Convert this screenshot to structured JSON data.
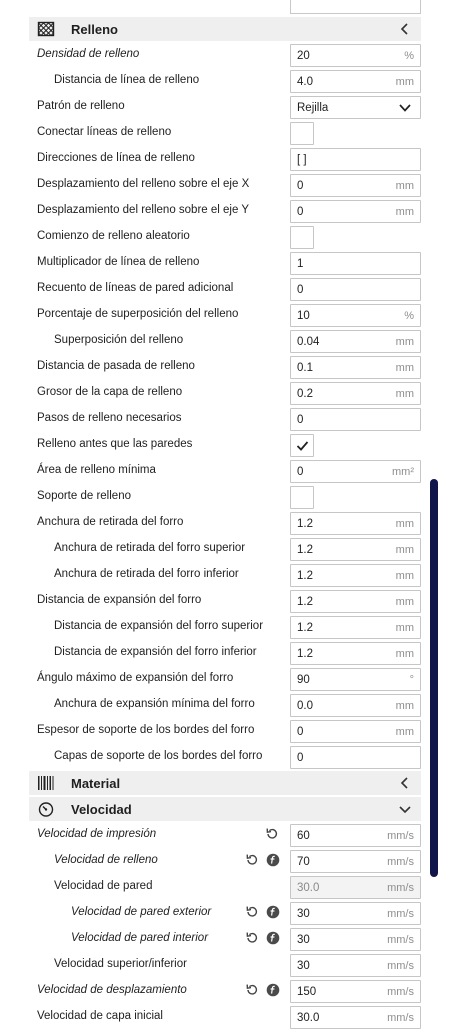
{
  "sections": {
    "infill": {
      "title": "Relleno"
    },
    "material": {
      "title": "Material"
    },
    "speed": {
      "title": "Velocidad"
    }
  },
  "infill_settings": [
    {
      "label": "Densidad de relleno",
      "value": "20",
      "unit": "%",
      "type": "text",
      "indent": 0,
      "italic": true
    },
    {
      "label": "Distancia de línea de relleno",
      "value": "4.0",
      "unit": "mm",
      "type": "text",
      "indent": 1
    },
    {
      "label": "Patrón de relleno",
      "value": "Rejilla",
      "type": "combo",
      "indent": 0
    },
    {
      "label": "Conectar líneas de relleno",
      "type": "check",
      "checked": false,
      "indent": 0
    },
    {
      "label": "Direcciones de línea de relleno",
      "value": "[ ]",
      "unit": "",
      "type": "text",
      "indent": 0
    },
    {
      "label": "Desplazamiento del relleno sobre el eje X",
      "value": "0",
      "unit": "mm",
      "type": "text",
      "indent": 0
    },
    {
      "label": "Desplazamiento del relleno sobre el eje Y",
      "value": "0",
      "unit": "mm",
      "type": "text",
      "indent": 0
    },
    {
      "label": "Comienzo de relleno aleatorio",
      "type": "check",
      "checked": false,
      "indent": 0
    },
    {
      "label": "Multiplicador de línea de relleno",
      "value": "1",
      "unit": "",
      "type": "text",
      "indent": 0
    },
    {
      "label": "Recuento de líneas de pared adicional",
      "value": "0",
      "unit": "",
      "type": "text",
      "indent": 0
    },
    {
      "label": "Porcentaje de superposición del relleno",
      "value": "10",
      "unit": "%",
      "type": "text",
      "indent": 0
    },
    {
      "label": "Superposición del relleno",
      "value": "0.04",
      "unit": "mm",
      "type": "text",
      "indent": 1
    },
    {
      "label": "Distancia de pasada de relleno",
      "value": "0.1",
      "unit": "mm",
      "type": "text",
      "indent": 0
    },
    {
      "label": "Grosor de la capa de relleno",
      "value": "0.2",
      "unit": "mm",
      "type": "text",
      "indent": 0
    },
    {
      "label": "Pasos de relleno necesarios",
      "value": "0",
      "unit": "",
      "type": "text",
      "indent": 0
    },
    {
      "label": "Relleno antes que las paredes",
      "type": "check",
      "checked": true,
      "indent": 0
    },
    {
      "label": "Área de relleno mínima",
      "value": "0",
      "unit": "mm²",
      "type": "text",
      "indent": 0
    },
    {
      "label": "Soporte de relleno",
      "type": "check",
      "checked": false,
      "indent": 0
    },
    {
      "label": "Anchura de retirada del forro",
      "value": "1.2",
      "unit": "mm",
      "type": "text",
      "indent": 0
    },
    {
      "label": "Anchura de retirada del forro superior",
      "value": "1.2",
      "unit": "mm",
      "type": "text",
      "indent": 1
    },
    {
      "label": "Anchura de retirada del forro inferior",
      "value": "1.2",
      "unit": "mm",
      "type": "text",
      "indent": 1
    },
    {
      "label": "Distancia de expansión del forro",
      "value": "1.2",
      "unit": "mm",
      "type": "text",
      "indent": 0
    },
    {
      "label": "Distancia de expansión del forro superior",
      "value": "1.2",
      "unit": "mm",
      "type": "text",
      "indent": 1
    },
    {
      "label": "Distancia de expansión del forro inferior",
      "value": "1.2",
      "unit": "mm",
      "type": "text",
      "indent": 1
    },
    {
      "label": "Ángulo máximo de expansión del forro",
      "value": "90",
      "unit": "°",
      "type": "text",
      "indent": 0
    },
    {
      "label": "Anchura de expansión mínima del forro",
      "value": "0.0",
      "unit": "mm",
      "type": "text",
      "indent": 1
    },
    {
      "label": "Espesor de soporte de los bordes del forro",
      "value": "0",
      "unit": "mm",
      "type": "text",
      "indent": 0
    },
    {
      "label": "Capas de soporte de los bordes del forro",
      "value": "0",
      "unit": "",
      "type": "text",
      "indent": 1
    }
  ],
  "speed_settings": [
    {
      "label": "Velocidad de impresión",
      "value": "60",
      "unit": "mm/s",
      "type": "text",
      "indent": 0,
      "italic": true,
      "reset": true
    },
    {
      "label": "Velocidad de relleno",
      "value": "70",
      "unit": "mm/s",
      "type": "text",
      "indent": 1,
      "italic": true,
      "reset": true,
      "fx": true
    },
    {
      "label": "Velocidad de pared",
      "value": "30.0",
      "unit": "mm/s",
      "type": "text",
      "indent": 1,
      "disabled": true
    },
    {
      "label": "Velocidad de pared exterior",
      "value": "30",
      "unit": "mm/s",
      "type": "text",
      "indent": 2,
      "italic": true,
      "reset": true,
      "fx": true
    },
    {
      "label": "Velocidad de pared interior",
      "value": "30",
      "unit": "mm/s",
      "type": "text",
      "indent": 2,
      "italic": true,
      "reset": true,
      "fx": true
    },
    {
      "label": "Velocidad superior/inferior",
      "value": "30",
      "unit": "mm/s",
      "type": "text",
      "indent": 1
    },
    {
      "label": "Velocidad de desplazamiento",
      "value": "150",
      "unit": "mm/s",
      "type": "text",
      "indent": 0,
      "italic": true,
      "reset": true,
      "fx": true
    },
    {
      "label": "Velocidad de capa inicial",
      "value": "30.0",
      "unit": "mm/s",
      "type": "text",
      "indent": 0
    }
  ],
  "icons": {
    "infill": "infill-pattern-icon",
    "material": "material-barcode-icon",
    "speed": "speedometer-icon",
    "collapsed": "chevron-left-icon",
    "expanded": "chevron-down-icon",
    "reset": "reset-icon",
    "function": "function-icon",
    "check": "checkmark-icon"
  },
  "colors": {
    "header_bg": "#efefef",
    "scrollbar": "#10164a",
    "field_border": "#c6c6c6"
  }
}
